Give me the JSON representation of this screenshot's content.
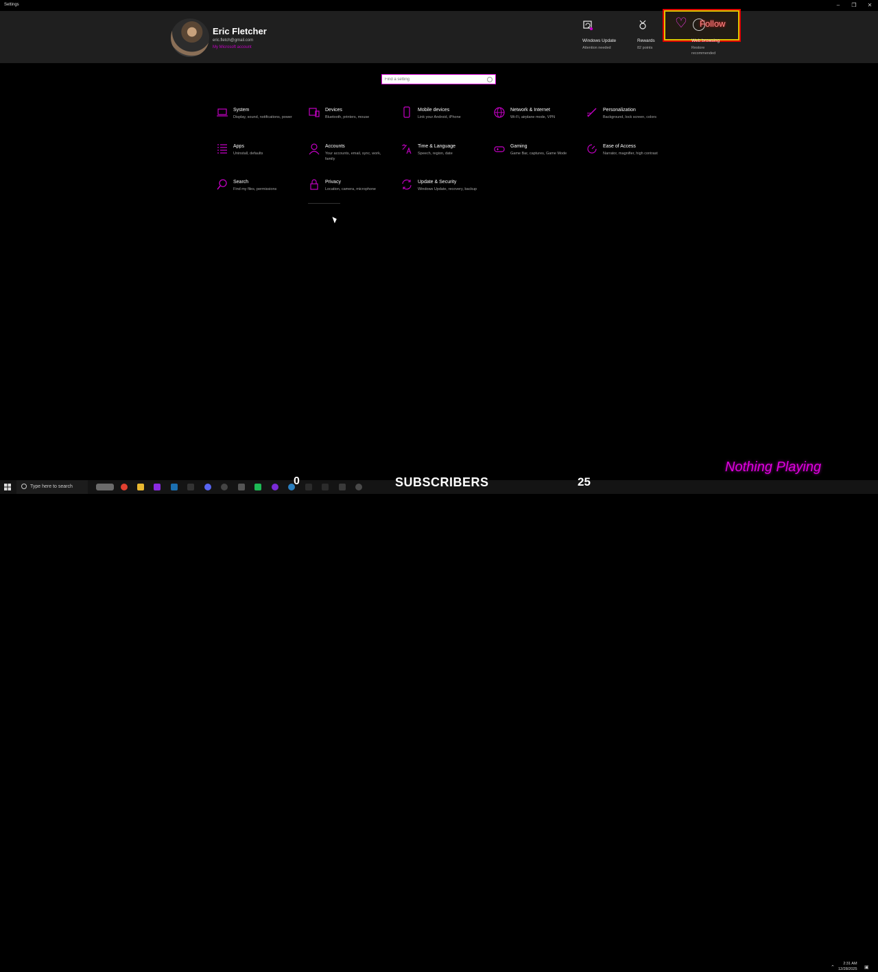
{
  "window": {
    "title": "Settings"
  },
  "profile": {
    "name": "Eric Fletcher",
    "email": "eric.fletch@gmail.com",
    "link": "My Microsoft account"
  },
  "quick_actions": [
    {
      "title": "Windows Update",
      "subtitle": "Attention needed",
      "icon": "windows-update-icon"
    },
    {
      "title": "Rewards",
      "subtitle": "82 points",
      "icon": "rewards-icon"
    },
    {
      "title": "Web browsing",
      "subtitle": "Restore recommended",
      "icon": "globe-icon"
    }
  ],
  "overlay": {
    "follow_text": "Follow"
  },
  "search": {
    "placeholder": "Find a setting"
  },
  "categories": [
    {
      "title": "System",
      "desc": "Display, sound, notifications, power",
      "icon": "laptop-icon"
    },
    {
      "title": "Devices",
      "desc": "Bluetooth, printers, mouse",
      "icon": "devices-icon"
    },
    {
      "title": "Mobile devices",
      "desc": "Link your Android, iPhone",
      "icon": "phone-icon"
    },
    {
      "title": "Network & Internet",
      "desc": "Wi-Fi, airplane mode, VPN",
      "icon": "globe-icon"
    },
    {
      "title": "Personalization",
      "desc": "Background, lock screen, colors",
      "icon": "brush-icon"
    },
    {
      "title": "Apps",
      "desc": "Uninstall, defaults",
      "icon": "apps-list-icon"
    },
    {
      "title": "Accounts",
      "desc": "Your accounts, email, sync, work, family",
      "icon": "person-icon"
    },
    {
      "title": "Time & Language",
      "desc": "Speech, region, date",
      "icon": "time-language-icon"
    },
    {
      "title": "Gaming",
      "desc": "Game Bar, captures, Game Mode",
      "icon": "gamepad-icon"
    },
    {
      "title": "Ease of Access",
      "desc": "Narrator, magnifier, high contrast",
      "icon": "ease-of-access-icon"
    },
    {
      "title": "Search",
      "desc": "Find my files, permissions",
      "icon": "search-icon"
    },
    {
      "title": "Privacy",
      "desc": "Location, camera, microphone",
      "icon": "lock-icon"
    },
    {
      "title": "Update & Security",
      "desc": "Windows Update, recovery, backup",
      "icon": "sync-icon"
    }
  ],
  "taskbar": {
    "search_placeholder": "Type here to search",
    "counter_left": "0",
    "subscribers_label": "SUBSCRIBERS",
    "counter_right": "25",
    "now_playing": "Nothing Playing",
    "time": "2:31 AM",
    "date": "12/28/2025"
  },
  "colors": {
    "accent": "#c500c5",
    "background": "#000000",
    "header": "#1f1f1f"
  }
}
